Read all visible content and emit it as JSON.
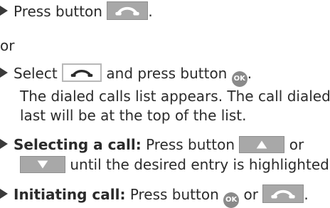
{
  "step1": {
    "text_before": "Press button",
    "text_after": "."
  },
  "or_label": "or",
  "step2": {
    "text_select": "Select",
    "text_mid": "and press button",
    "text_end": "."
  },
  "ok_label": "OK",
  "para": {
    "line1": "The dialed calls list appears. The call dialed",
    "line2": "last will be at the top of the list."
  },
  "step3": {
    "bold": "Selecting a call:",
    "text1": "Press button",
    "text2": "or",
    "text3": "until the desired entry is highlighted."
  },
  "step4": {
    "bold": "Initiating call:",
    "text1": "Press button",
    "text2": "or",
    "text3": "."
  },
  "icons": {
    "bullet": "triangle-bullet-icon",
    "phone_button": "phone-handset-icon",
    "phone_softkey": "phone-handset-outline-icon",
    "ok_button": "ok-circle-icon",
    "up_button": "arrow-up-icon",
    "down_button": "arrow-down-icon"
  },
  "colors": {
    "text": "#2b2b2b",
    "key_gray": "#a8a8a8",
    "ok_gray": "#8a8a8a"
  }
}
